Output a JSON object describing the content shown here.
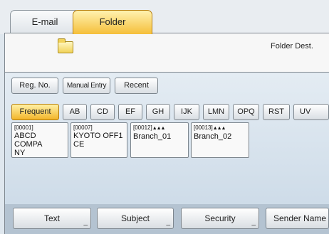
{
  "tabs": {
    "email": "E-mail",
    "folder": "Folder"
  },
  "dest_label": "Folder Dest.",
  "mode_buttons": {
    "reg_no": "Reg. No.",
    "manual": "Manual Entry",
    "recent": "Recent"
  },
  "index_tabs": [
    "Frequent",
    "AB",
    "CD",
    "EF",
    "GH",
    "IJK",
    "LMN",
    "OPQ",
    "RST",
    "UV"
  ],
  "entries": [
    {
      "code": "[00001]",
      "group": "",
      "name_line1": "ABCD COMPA",
      "name_line2": "NY"
    },
    {
      "code": "[00007]",
      "group": "",
      "name_line1": "KYOTO OFF1",
      "name_line2": "CE"
    },
    {
      "code": "[00012]",
      "group": "▲▲▲",
      "name_line1": "Branch_01",
      "name_line2": ""
    },
    {
      "code": "[00013]",
      "group": "▲▲▲",
      "name_line1": "Branch_02",
      "name_line2": ""
    }
  ],
  "bottom_buttons": {
    "text": "Text",
    "subject": "Subject",
    "security": "Security",
    "sender": "Sender Name"
  },
  "colors": {
    "active_tab": "#f5bf3a",
    "background": "#dfe7ee",
    "bottom_band": "#b4c3d1"
  }
}
